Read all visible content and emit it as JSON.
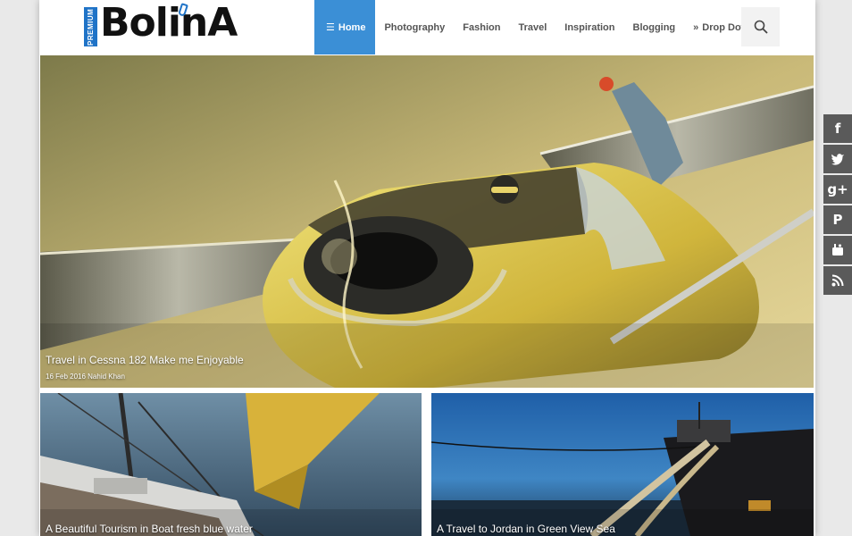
{
  "logo": {
    "premium": "PREMIUM",
    "brand": "BolinA"
  },
  "nav": {
    "items": [
      {
        "label": "Home",
        "active": true
      },
      {
        "label": "Photography"
      },
      {
        "label": "Fashion"
      },
      {
        "label": "Travel"
      },
      {
        "label": "Inspiration"
      },
      {
        "label": "Blogging"
      },
      {
        "label": "Drop Down"
      }
    ]
  },
  "hero": {
    "title": "Travel in Cessna 182 Make me Enjoyable",
    "meta": "16 Feb 2016 Nahid Khan"
  },
  "cards": [
    {
      "title": "A Beautiful Tourism in Boat fresh blue water"
    },
    {
      "title": "A Travel to Jordan in Green View Sea"
    }
  ],
  "social": [
    "facebook-icon",
    "twitter-icon",
    "google-plus-icon",
    "pinterest-icon",
    "youtube-icon",
    "rss-icon"
  ],
  "colors": {
    "accent": "#3b8fd6",
    "social_bg": "#5a5a5a"
  }
}
